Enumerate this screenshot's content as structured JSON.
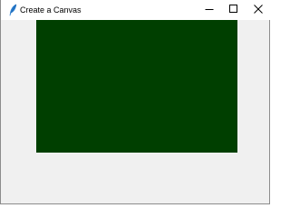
{
  "window": {
    "title": "Create a Canvas",
    "controls": {
      "minimize_icon": "minimize-icon",
      "maximize_icon": "maximize-icon",
      "close_icon": "close-icon"
    },
    "app_icon": "feather-icon"
  },
  "canvas": {
    "fill_color": "#003f00"
  },
  "colors": {
    "window_bg": "#f0f0f0",
    "titlebar_bg": "#ffffff"
  }
}
